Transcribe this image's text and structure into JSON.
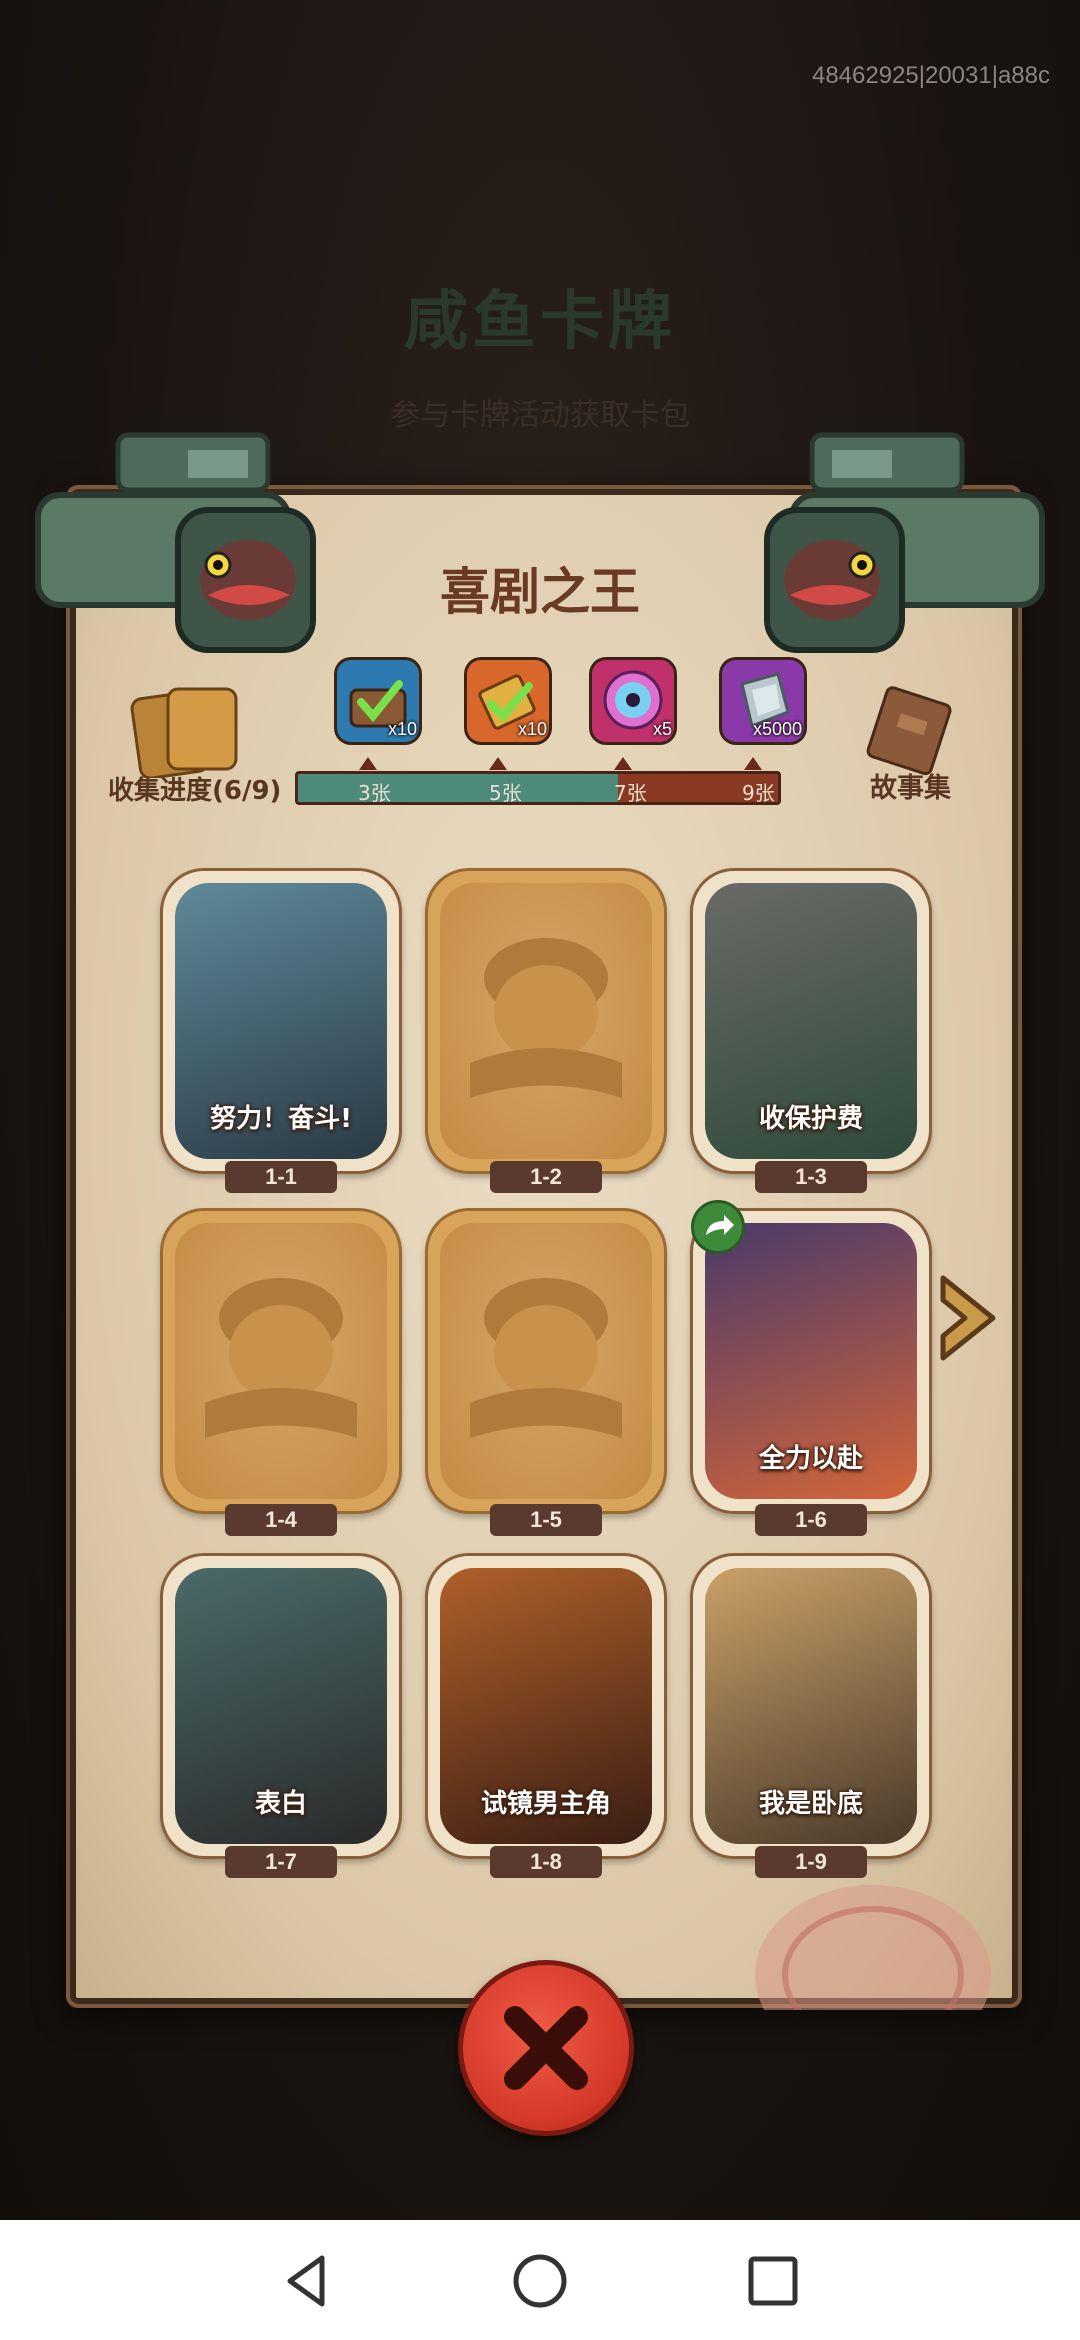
{
  "build_id": "48462925|20031|a88c",
  "background": {
    "title": "咸鱼卡牌",
    "subtitle": "参与卡牌活动获取卡包"
  },
  "panel": {
    "title": "喜剧之王",
    "progress_label": "收集进度(6/9)",
    "story_label": "故事集",
    "progress": {
      "collected": 6,
      "total": 9
    },
    "rewards": [
      {
        "icon": "treasure-chest-icon",
        "count": "x10",
        "color": "#2c7ab0"
      },
      {
        "icon": "golden-ticket-icon",
        "count": "x10",
        "color": "#d9662a"
      },
      {
        "icon": "disc-icon",
        "count": "x5",
        "color": "#c0306a"
      },
      {
        "icon": "gem-icon",
        "count": "x5000",
        "color": "#8a3aa8"
      }
    ],
    "milestones": [
      "3张",
      "5张",
      "7张",
      "9张"
    ]
  },
  "cards": [
    {
      "id": "1-1",
      "title": "努力！奋斗!",
      "locked": false,
      "palette": [
        "#5f8a9a",
        "#2a3a44"
      ]
    },
    {
      "id": "1-2",
      "title": "",
      "locked": true
    },
    {
      "id": "1-3",
      "title": "收保护费",
      "locked": false,
      "palette": [
        "#6a6a66",
        "#2e4a3a"
      ]
    },
    {
      "id": "1-4",
      "title": "",
      "locked": true
    },
    {
      "id": "1-5",
      "title": "",
      "locked": true
    },
    {
      "id": "1-6",
      "title": "全力以赴",
      "locked": false,
      "palette": [
        "#4a3a6a",
        "#d4663a"
      ],
      "shared": true
    },
    {
      "id": "1-7",
      "title": "表白",
      "locked": false,
      "palette": [
        "#4a6a6a",
        "#2a2a2a"
      ]
    },
    {
      "id": "1-8",
      "title": "试镜男主角",
      "locked": false,
      "palette": [
        "#b0602a",
        "#3a1e14"
      ]
    },
    {
      "id": "1-9",
      "title": "我是卧底",
      "locked": false,
      "palette": [
        "#c9a068",
        "#4a3a2a"
      ]
    }
  ],
  "colors": {
    "accent_red": "#d63a2a",
    "panel_title": "#6b3a22",
    "bar_fill": "#4e8a7a",
    "bar_empty": "#8a3a22"
  },
  "controls": {
    "close_icon": "close-x-icon",
    "next_icon": "next-arrow-icon"
  },
  "navbar": {
    "back_icon": "back-triangle-icon",
    "home_icon": "home-circle-icon",
    "recents_icon": "recents-square-icon"
  }
}
